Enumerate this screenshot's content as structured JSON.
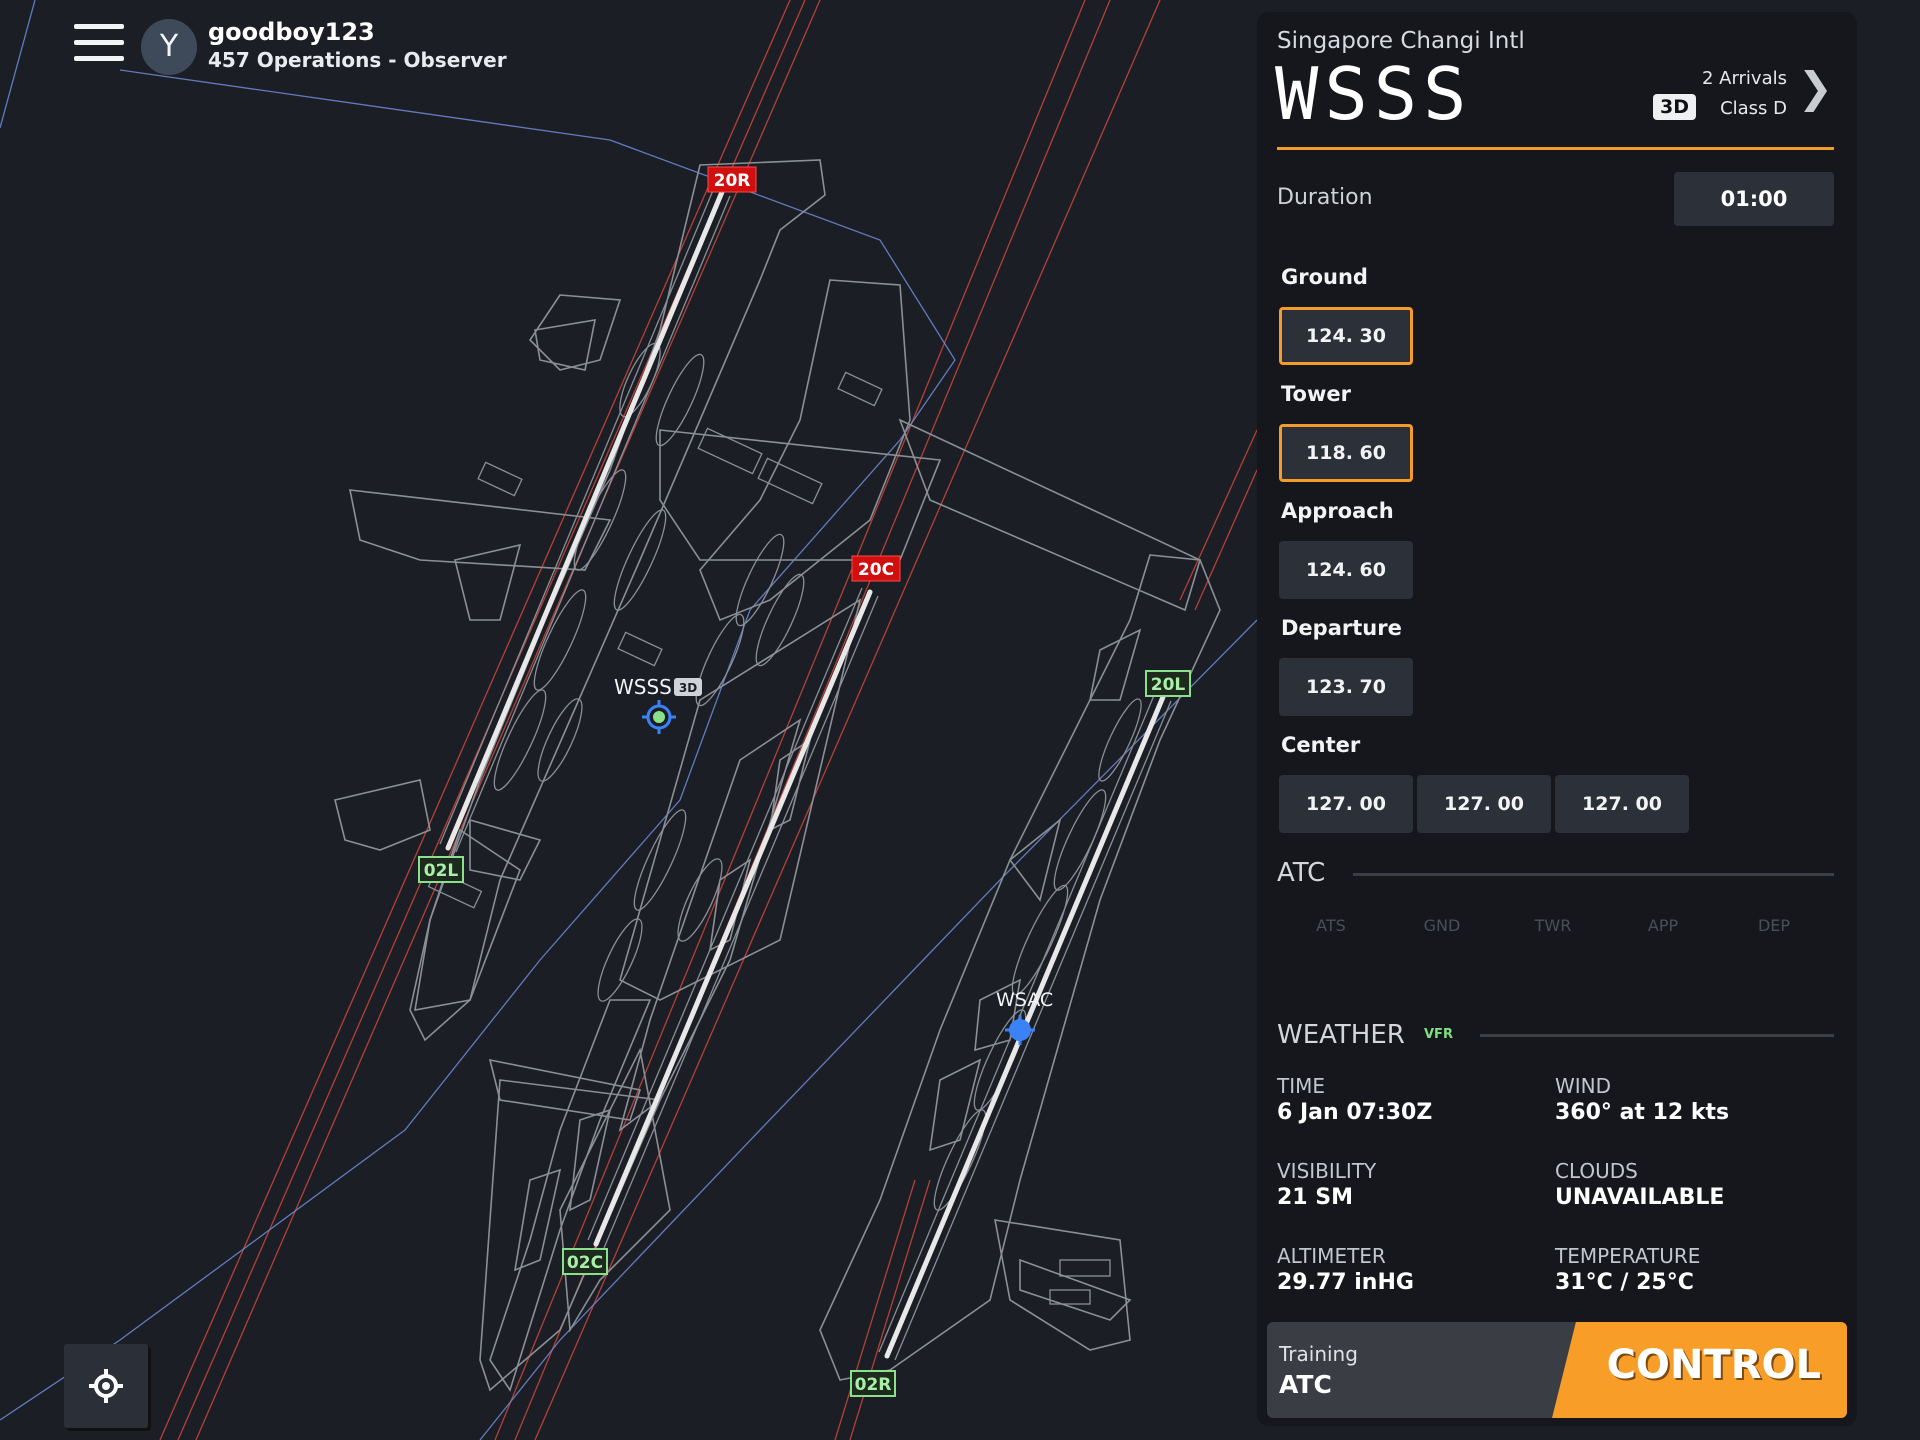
{
  "header": {
    "avatar_initial": "Y",
    "username": "goodboy123",
    "role": "457 Operations - Observer"
  },
  "map": {
    "airport_label": "WSSS",
    "airport_badge": "3D",
    "secondary_airport_label": "WSAC",
    "runways": {
      "r20R": "20R",
      "r20C": "20C",
      "r20L": "20L",
      "r02L": "02L",
      "r02C": "02C",
      "r02R": "02R"
    },
    "colors": {
      "background": "#1b1e25",
      "taxiway": "#8b8f96",
      "runway": "#e8e8e8",
      "approach_line": "#c4453b",
      "boundary_line": "#6f8cd9",
      "departure_label": "#d10f0f",
      "arrival_label": "#8be08b"
    }
  },
  "panel": {
    "airport_name": "Singapore Changi Intl",
    "icao": "WSSS",
    "badge_3d": "3D",
    "arrivals": "2 Arrivals",
    "airspace_class": "Class D",
    "duration_label": "Duration",
    "duration_value": "01:00",
    "frequencies": {
      "ground": {
        "label": "Ground",
        "values": [
          "124. 30"
        ],
        "active": true
      },
      "tower": {
        "label": "Tower",
        "values": [
          "118. 60"
        ],
        "active": true
      },
      "approach": {
        "label": "Approach",
        "values": [
          "124. 60"
        ],
        "active": false
      },
      "departure": {
        "label": "Departure",
        "values": [
          "123. 70"
        ],
        "active": false
      },
      "center": {
        "label": "Center",
        "values": [
          "127. 00",
          "127. 00",
          "127. 00"
        ],
        "active": false
      }
    },
    "atc": {
      "title": "ATC",
      "tabs": [
        "ATS",
        "GND",
        "TWR",
        "APP",
        "DEP"
      ]
    },
    "weather": {
      "title": "WEATHER",
      "flight_rules": "VFR",
      "time_label": "TIME",
      "time_value": "6 Jan 07:30Z",
      "wind_label": "WIND",
      "wind_value": "360° at 12 kts",
      "visibility_label": "VISIBILITY",
      "visibility_value": "21 SM",
      "clouds_label": "CLOUDS",
      "clouds_value": "UNAVAILABLE",
      "altimeter_label": "ALTIMETER",
      "altimeter_value": "29.77 inHG",
      "temperature_label": "TEMPERATURE",
      "temperature_value": "31°C / 25°C"
    },
    "control_bar": {
      "training_label": "Training",
      "training_value": "ATC",
      "control_label": "CONTROL",
      "accent": "#f89e28"
    }
  },
  "icons": {
    "menu": "hamburger-menu-icon",
    "next": "chevron-right-icon",
    "locate": "crosshair-locate-icon",
    "airport": "airport-target-icon"
  }
}
